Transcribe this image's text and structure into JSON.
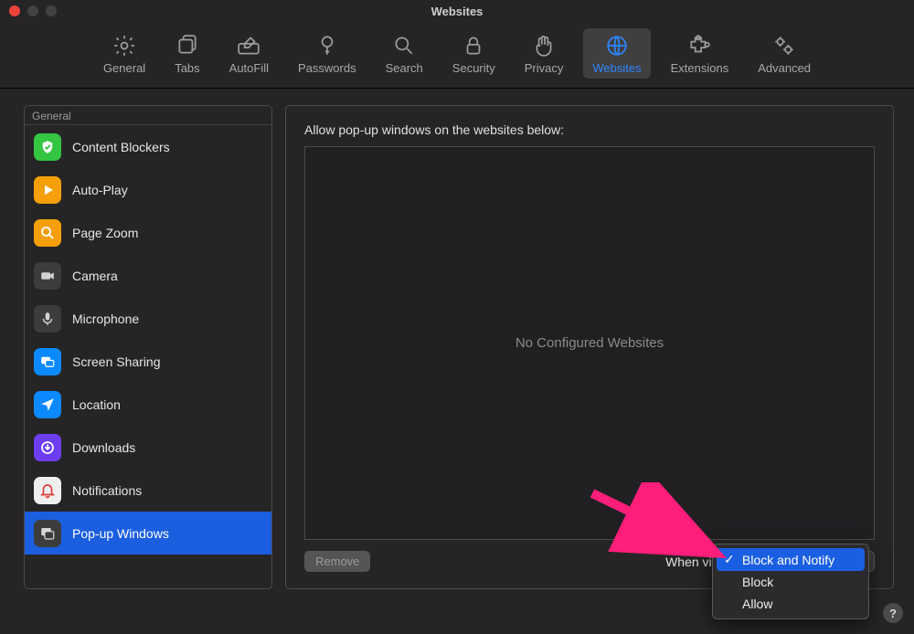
{
  "window": {
    "title": "Websites"
  },
  "toolbar": {
    "items": [
      {
        "id": "general",
        "label": "General"
      },
      {
        "id": "tabs",
        "label": "Tabs"
      },
      {
        "id": "autofill",
        "label": "AutoFill"
      },
      {
        "id": "passwords",
        "label": "Passwords"
      },
      {
        "id": "search",
        "label": "Search"
      },
      {
        "id": "security",
        "label": "Security"
      },
      {
        "id": "privacy",
        "label": "Privacy"
      },
      {
        "id": "websites",
        "label": "Websites",
        "active": true
      },
      {
        "id": "extensions",
        "label": "Extensions"
      },
      {
        "id": "advanced",
        "label": "Advanced"
      }
    ]
  },
  "sidebar": {
    "section": "General",
    "items": [
      {
        "id": "content-blockers",
        "label": "Content Blockers",
        "bg": "#34c541",
        "icon": "shield-check"
      },
      {
        "id": "auto-play",
        "label": "Auto-Play",
        "bg": "#f59f0a",
        "icon": "play"
      },
      {
        "id": "page-zoom",
        "label": "Page Zoom",
        "bg": "#f59f0a",
        "icon": "magnify"
      },
      {
        "id": "camera",
        "label": "Camera",
        "bg": "#3c3c3d",
        "icon": "camera"
      },
      {
        "id": "microphone",
        "label": "Microphone",
        "bg": "#3c3c3d",
        "icon": "mic"
      },
      {
        "id": "screen-sharing",
        "label": "Screen Sharing",
        "bg": "#0b8aff",
        "icon": "screens"
      },
      {
        "id": "location",
        "label": "Location",
        "bg": "#0b8aff",
        "icon": "location"
      },
      {
        "id": "downloads",
        "label": "Downloads",
        "bg": "#6c3df1",
        "icon": "download"
      },
      {
        "id": "notifications",
        "label": "Notifications",
        "bg": "#efefef",
        "icon": "bell",
        "fg": "#e23b3b"
      },
      {
        "id": "popup-windows",
        "label": "Pop-up Windows",
        "bg": "#3c3c3d",
        "icon": "popup",
        "selected": true
      }
    ]
  },
  "panel": {
    "heading": "Allow pop-up windows on the websites below:",
    "emptyText": "No Configured Websites",
    "removeLabel": "Remove",
    "whenLabel": "When visiting other websites:"
  },
  "dropdown": {
    "options": [
      {
        "label": "Block and Notify",
        "selected": true
      },
      {
        "label": "Block"
      },
      {
        "label": "Allow"
      }
    ]
  },
  "help": {
    "label": "?"
  }
}
